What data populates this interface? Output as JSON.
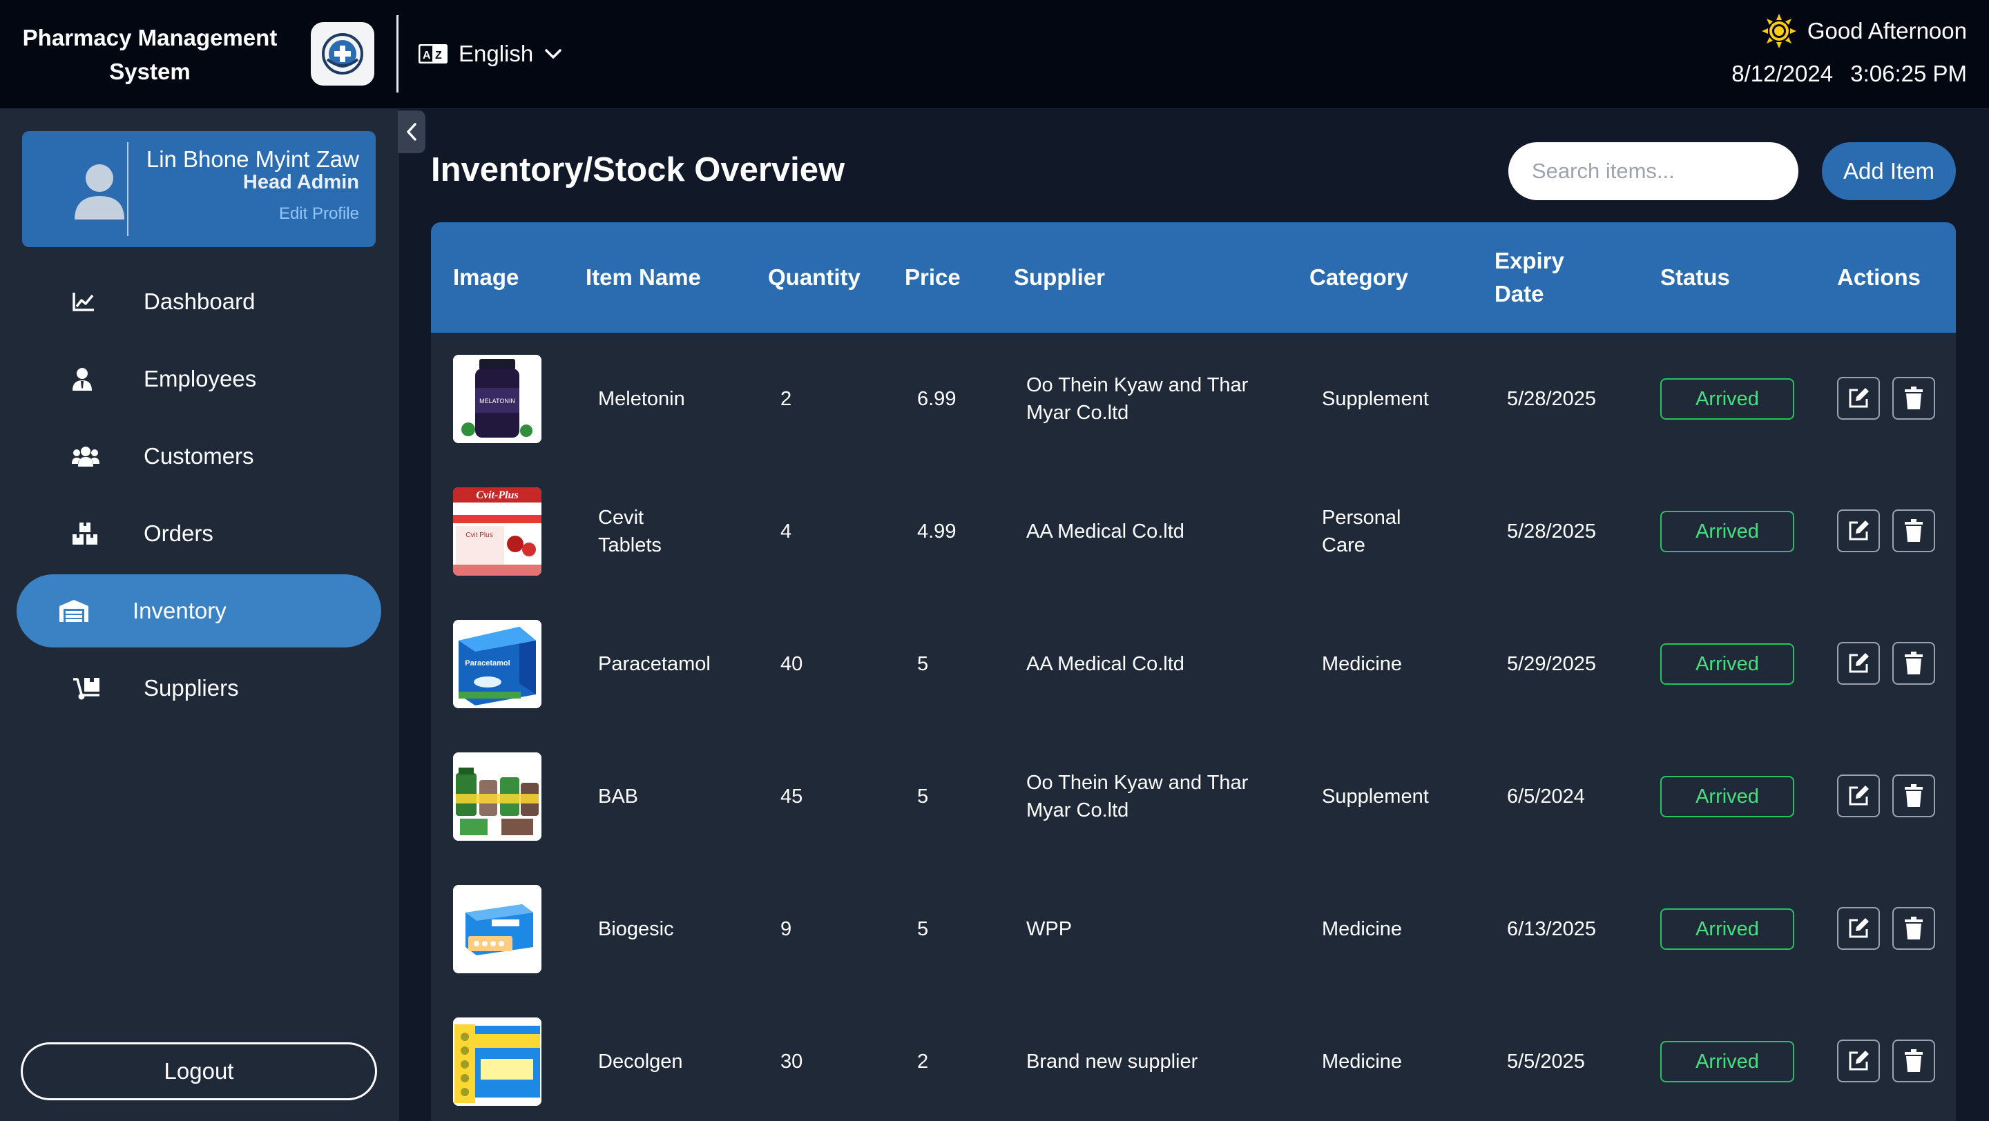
{
  "app": {
    "title_line1": "Pharmacy Management",
    "title_line2": "System",
    "language": "English"
  },
  "header": {
    "greeting": "Good Afternoon",
    "date": "8/12/2024",
    "time": "3:06:25 PM"
  },
  "profile": {
    "name": "Lin Bhone Myint Zaw",
    "role": "Head Admin",
    "edit_label": "Edit Profile"
  },
  "sidebar": {
    "items": [
      {
        "label": "Dashboard",
        "icon": "chart-line-icon"
      },
      {
        "label": "Employees",
        "icon": "user-tie-icon"
      },
      {
        "label": "Customers",
        "icon": "users-icon"
      },
      {
        "label": "Orders",
        "icon": "boxes-icon"
      },
      {
        "label": "Inventory",
        "icon": "warehouse-icon",
        "active": true
      },
      {
        "label": "Suppliers",
        "icon": "dolly-icon"
      }
    ],
    "logout_label": "Logout"
  },
  "main": {
    "title": "Inventory/Stock Overview",
    "search_placeholder": "Search items...",
    "add_label": "Add Item"
  },
  "table": {
    "headers": {
      "image": "Image",
      "item_name": "Item Name",
      "quantity": "Quantity",
      "price": "Price",
      "supplier": "Supplier",
      "category": "Category",
      "expiry_line1": "Expiry",
      "expiry_line2": "Date",
      "status": "Status",
      "actions": "Actions"
    },
    "rows": [
      {
        "name": "Meletonin",
        "quantity": "2",
        "price": "6.99",
        "supplier_line1": "Oo Thein Kyaw and Thar",
        "supplier_line2": "Myar Co.ltd",
        "category_line1": "Supplement",
        "category_line2": "",
        "expiry": "5/28/2025",
        "status": "Arrived",
        "image": "melatonin-bottle"
      },
      {
        "name_line1": "Cevit",
        "name_line2": "Tablets",
        "quantity": "4",
        "price": "4.99",
        "supplier_line1": "AA Medical Co.ltd",
        "supplier_line2": "",
        "category_line1": "Personal",
        "category_line2": "Care",
        "expiry": "5/28/2025",
        "status": "Arrived",
        "image": "cvit-plus-box",
        "image_text": "Cvit-Plus"
      },
      {
        "name": "Paracetamol",
        "quantity": "40",
        "price": "5",
        "supplier_line1": "AA Medical Co.ltd",
        "supplier_line2": "",
        "category_line1": "Medicine",
        "category_line2": "",
        "expiry": "5/29/2025",
        "status": "Arrived",
        "image": "paracetamol-box",
        "image_text": "Paracetamol"
      },
      {
        "name": "BAB",
        "quantity": "45",
        "price": "5",
        "supplier_line1": "Oo Thein Kyaw and Thar",
        "supplier_line2": "Myar Co.ltd",
        "category_line1": "Supplement",
        "category_line2": "",
        "expiry": "6/5/2024",
        "status": "Arrived",
        "image": "bab-bottles"
      },
      {
        "name": "Biogesic",
        "quantity": "9",
        "price": "5",
        "supplier_line1": "WPP",
        "supplier_line2": "",
        "category_line1": "Medicine",
        "category_line2": "",
        "expiry": "6/13/2025",
        "status": "Arrived",
        "image": "biogesic-box"
      },
      {
        "name": "Decolgen",
        "quantity": "30",
        "price": "2",
        "supplier_line1": "Brand new supplier",
        "supplier_line2": "",
        "category_line1": "Medicine",
        "category_line2": "",
        "expiry": "5/5/2025",
        "status": "Arrived",
        "image": "decolgen-box"
      }
    ]
  },
  "colors": {
    "topbar": "#030712",
    "sidebar": "#1f2937",
    "accent": "#2b6cb0",
    "active_nav": "#3b82c4",
    "status_green": "#22c55e",
    "sun": "#facc15"
  }
}
